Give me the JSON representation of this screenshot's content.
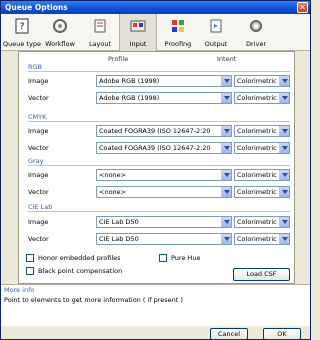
{
  "window": {
    "title": "Queue Options",
    "close_glyph": "✕"
  },
  "toolbar": {
    "tabs": [
      {
        "label": "Queue type",
        "icon": "queue-type-icon"
      },
      {
        "label": "Workflow",
        "icon": "workflow-icon"
      },
      {
        "label": "Layout",
        "icon": "layout-icon"
      },
      {
        "label": "Input",
        "icon": "input-icon",
        "active": true
      },
      {
        "label": "Proofing",
        "icon": "proofing-icon"
      },
      {
        "label": "Output",
        "icon": "output-icon"
      },
      {
        "label": "Driver",
        "icon": "driver-icon"
      }
    ]
  },
  "columns": {
    "profile": "Profile",
    "intent": "Intent"
  },
  "sections": {
    "rgb": {
      "title": "RGB",
      "image": {
        "label": "Image",
        "profile": "Adobe RGB (1998)",
        "intent": "Colorimetric"
      },
      "vector": {
        "label": "Vector",
        "profile": "Adobe RGB (1998)",
        "intent": "Colorimetric"
      }
    },
    "cmyk": {
      "title": "CMYK",
      "image": {
        "label": "Image",
        "profile": "Coated FOGRA39 (ISO 12647-2:20",
        "intent": "Colorimetric"
      },
      "vector": {
        "label": "Vector",
        "profile": "Coated FOGRA39 (ISO 12647-2:20",
        "intent": "Colorimetric"
      }
    },
    "gray": {
      "title": "Gray",
      "image": {
        "label": "Image",
        "profile": "<none>",
        "intent": "Colorimetric"
      },
      "vector": {
        "label": "Vector",
        "profile": "<none>",
        "intent": "Colorimetric"
      }
    },
    "cielab": {
      "title": "CIE Lab",
      "image": {
        "label": "Image",
        "profile": "CIE Lab D50",
        "intent": "Colorimetric"
      },
      "vector": {
        "label": "Vector",
        "profile": "CIE Lab D50",
        "intent": "Colorimetric"
      }
    }
  },
  "options": {
    "honor_embedded": "Honor embedded profiles",
    "pure_hue": "Pure Hue",
    "black_point": "Black point compensation",
    "load_csf": "Load CSF"
  },
  "more_info": {
    "title": "More info",
    "text": "Point to elements to get more information ( if present )"
  },
  "footer": {
    "cancel": "Cancel",
    "ok": "OK"
  }
}
